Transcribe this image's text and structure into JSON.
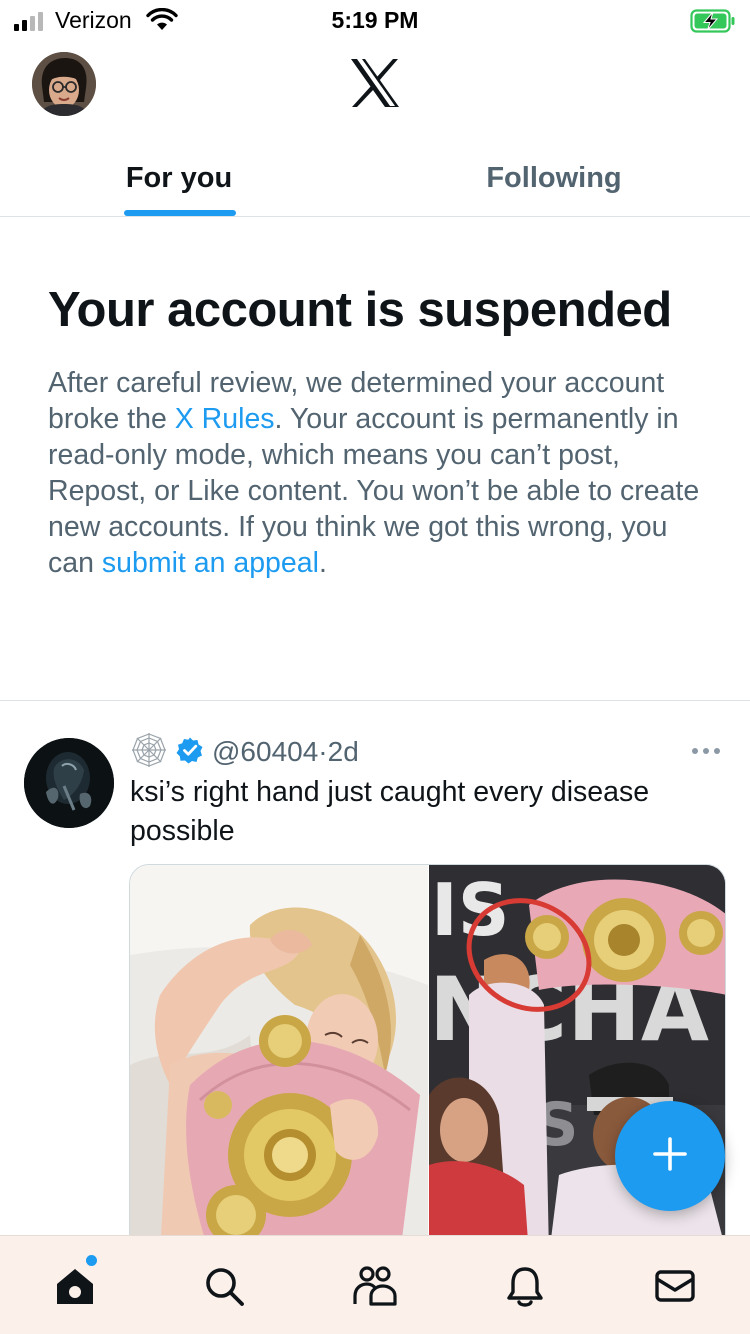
{
  "status_bar": {
    "carrier": "Verizon",
    "time": "5:19 PM"
  },
  "header": {
    "logo_icon": "x-logo-icon",
    "avatar_icon": "profile-avatar"
  },
  "tabs": [
    {
      "label": "For you",
      "active": true
    },
    {
      "label": "Following",
      "active": false
    }
  ],
  "suspension": {
    "title": "Your account is suspended",
    "body_part1": "After careful review, we determined your account broke the ",
    "rules_link": "X Rules",
    "body_part2": ". Your account is permanently in read-only mode, which means you can’t post, Repost, or Like content. You won’t be able to create new accounts. If you think we got this wrong, you can ",
    "appeal_link": "submit an appeal",
    "body_end": "."
  },
  "post": {
    "handle": "@60404",
    "separator": "·",
    "age": "2d",
    "verified": true,
    "text": "ksi’s right hand just caught every disease possible",
    "media": [
      "woman-with-pink-belt-photo",
      "ksi-holding-belt-photo"
    ]
  },
  "fab": {
    "icon": "plus-icon"
  },
  "bottom_nav": {
    "items": [
      "home-icon",
      "search-icon",
      "communities-icon",
      "notifications-icon",
      "messages-icon"
    ],
    "active": "home-icon"
  },
  "colors": {
    "accent": "#1d9bf0",
    "text_primary": "#0f1419",
    "text_secondary": "#536471",
    "battery_green": "#34c759",
    "nav_background": "#fbf0ea"
  }
}
